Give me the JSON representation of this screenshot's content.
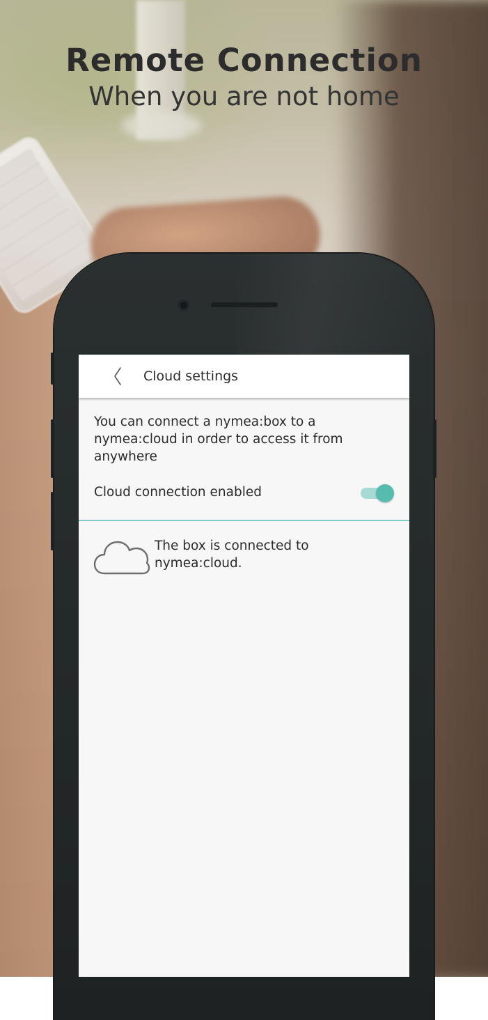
{
  "headline": {
    "title": "Remote Connection",
    "subtitle": "When you are not home"
  },
  "app": {
    "header": {
      "back_icon": "chevron-left-icon",
      "title": "Cloud settings"
    },
    "description": "You can connect a nymea:box to a nymea:cloud in order to access it from anywhere",
    "cloud_connection": {
      "label": "Cloud connection enabled",
      "enabled": true
    },
    "status": {
      "icon": "cloud-icon",
      "text": "The box is connected to nymea:cloud."
    }
  },
  "colors": {
    "accent": "#57bbae",
    "accent_light": "#a6dad3",
    "divider": "#7ecdc3",
    "screen_background": "#f7f7f7",
    "header_background": "#ffffff",
    "device_body": "#262b2b",
    "headline_text": "#2c2c2c"
  }
}
